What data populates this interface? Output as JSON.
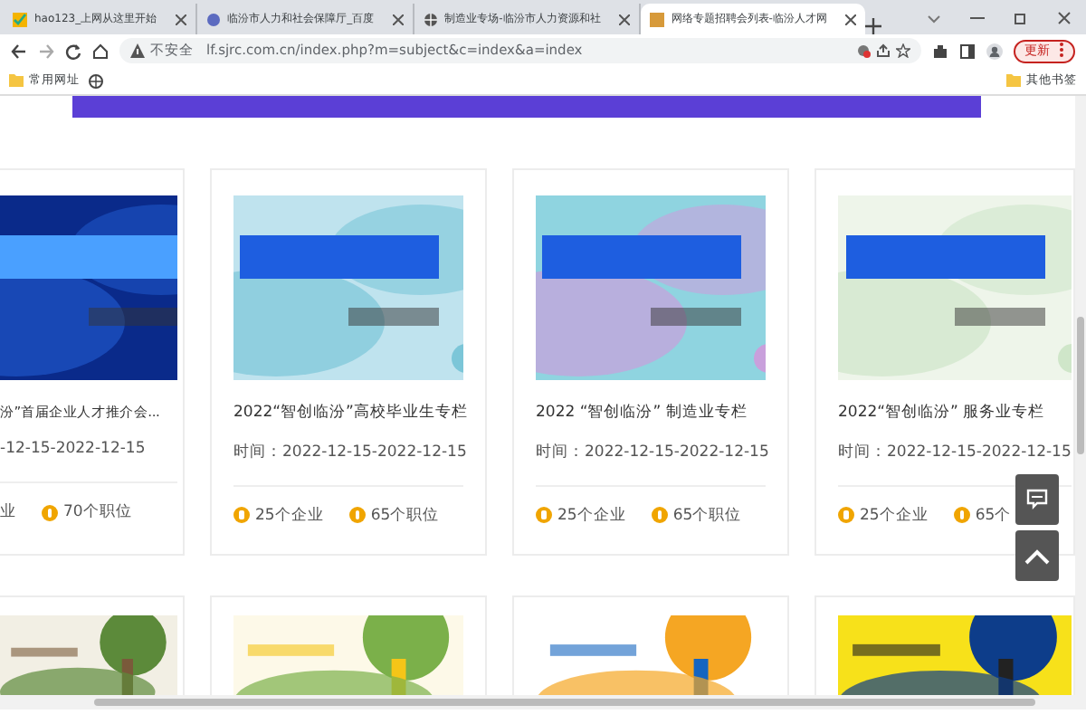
{
  "browser": {
    "tabs": [
      {
        "title": "hao123_上网从这里开始",
        "selected": false
      },
      {
        "title": "临汾市人力和社会保障厅_百度",
        "selected": false
      },
      {
        "title": "制造业专场-临汾市人力资源和社",
        "selected": false
      },
      {
        "title": "网络专题招聘会列表-临汾人才网",
        "selected": true
      }
    ],
    "security": "不安全",
    "url": "lf.sjrc.com.cn/index.php?m=subject&c=index&a=index",
    "update_button": "更新",
    "bookmarks": [
      "常用网址"
    ],
    "other_bookmarks": "其他书签"
  },
  "cards": [
    {
      "title": "汾”首届企业人才推介会...",
      "time": "-12-15-2022-12-15",
      "companies": "业",
      "positions": "70个职位"
    },
    {
      "title": "2022“智创临汾”高校毕业生专栏",
      "time": "时间：2022-12-15-2022-12-15",
      "companies": "25个企业",
      "positions": "65个职位"
    },
    {
      "title": "2022 “智创临汾” 制造业专栏",
      "time": "时间：2022-12-15-2022-12-15",
      "companies": "25个企业",
      "positions": "65个职位"
    },
    {
      "title": "2022“智创临汾” 服务业专栏",
      "time": "时间：2022-12-15-2022-12-15",
      "companies": "25个企业",
      "positions": "65个"
    }
  ]
}
